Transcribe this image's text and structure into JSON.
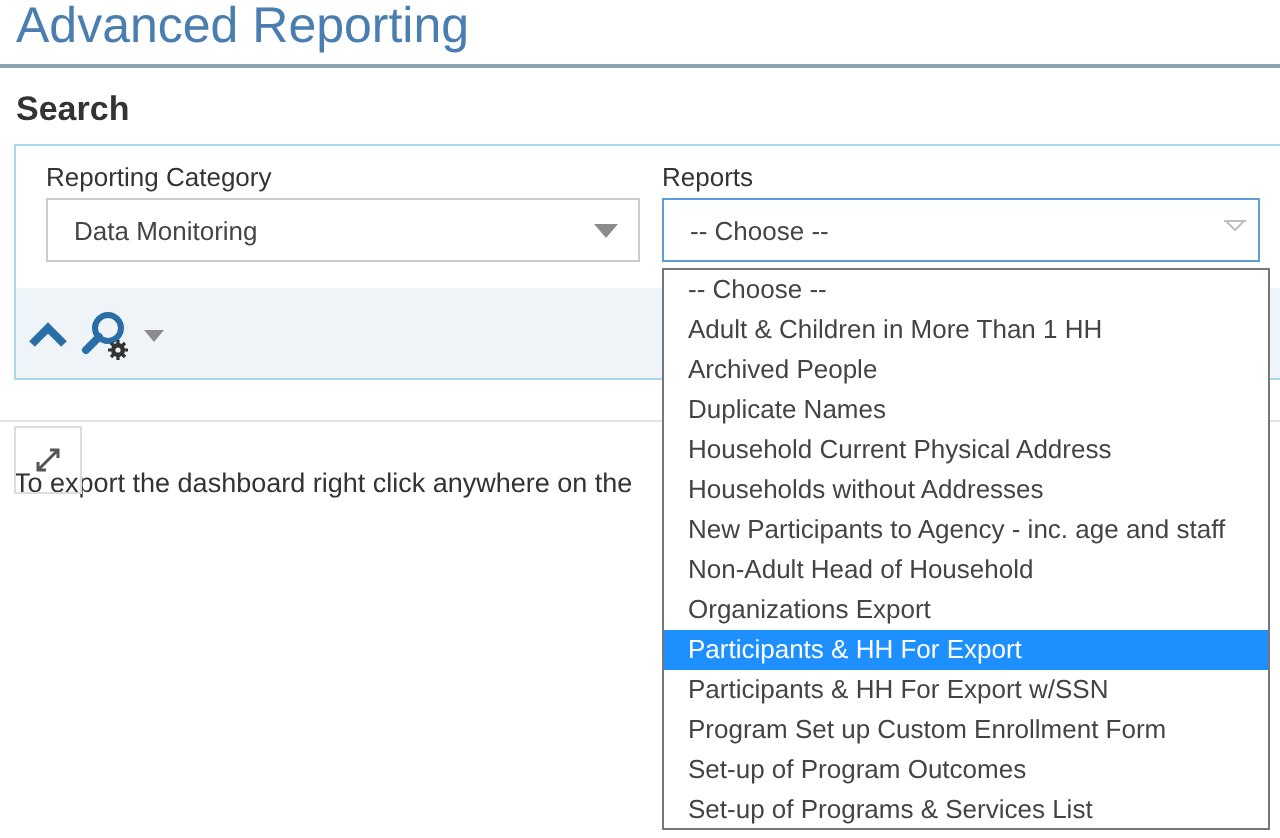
{
  "page": {
    "title": "Advanced Reporting"
  },
  "search": {
    "heading": "Search",
    "fields": [
      {
        "label": "Reporting Category",
        "value": "Data Monitoring",
        "focused": false
      },
      {
        "label": "Reports",
        "value": "-- Choose --",
        "focused": true
      }
    ]
  },
  "dropdown": {
    "options": [
      {
        "label": "-- Choose --",
        "selected": false
      },
      {
        "label": "Adult & Children in More Than 1 HH",
        "selected": false
      },
      {
        "label": "Archived People",
        "selected": false
      },
      {
        "label": "Duplicate Names",
        "selected": false
      },
      {
        "label": "Household Current Physical Address",
        "selected": false
      },
      {
        "label": "Households without Addresses",
        "selected": false
      },
      {
        "label": "New Participants to Agency - inc. age and staff",
        "selected": false
      },
      {
        "label": "Non-Adult Head of Household",
        "selected": false
      },
      {
        "label": "Organizations Export",
        "selected": false
      },
      {
        "label": "Participants & HH For Export",
        "selected": true
      },
      {
        "label": "Participants & HH For Export w/SSN",
        "selected": false
      },
      {
        "label": "Program Set up Custom Enrollment Form",
        "selected": false
      },
      {
        "label": "Set-up of Program Outcomes",
        "selected": false
      },
      {
        "label": "Set-up of Programs & Services List",
        "selected": false
      }
    ]
  },
  "dashboard": {
    "note": "To export the dashboard right click anywhere on the"
  }
}
